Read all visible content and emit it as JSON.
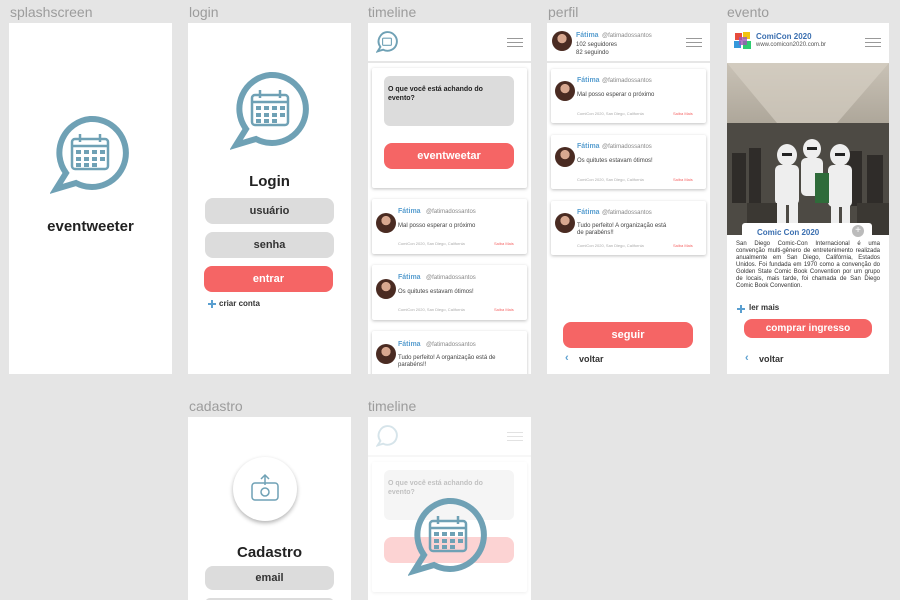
{
  "colors": {
    "accent": "#f56565",
    "brand": "#6fa1b5",
    "field": "#dcdcdc",
    "link": "#5a9fd0"
  },
  "labels": {
    "splash": "splashscreen",
    "login": "login",
    "timeline": "timeline",
    "perfil": "perfil",
    "evento": "evento",
    "cadastro": "cadastro",
    "timeline2": "timeline"
  },
  "splash": {
    "app_name": "eventweeter"
  },
  "login": {
    "title": "Login",
    "user_placeholder": "usuário",
    "password_placeholder": "senha",
    "submit": "entrar",
    "create_account": "criar conta"
  },
  "timeline": {
    "prompt": "O que você está achando do evento?",
    "submit": "eventweetar"
  },
  "posts": [
    {
      "name": "Fátima",
      "handle": "@fatimadossantos",
      "text": "Mal posso esperar o próximo",
      "meta": "ComiCon 2020, San Diego, California",
      "more": "Saiba Mais"
    },
    {
      "name": "Fátima",
      "handle": "@fatimadossantos",
      "text": "Os quitutes estavam ótimos!",
      "meta": "ComiCon 2020, San Diego, California",
      "more": "Saiba Mais"
    },
    {
      "name": "Fátima",
      "handle": "@fatimadossantos",
      "text": "Tudo perfeito! A organização está de parabéns!!",
      "meta": "ComiCon 2020, San Diego, California",
      "more": "Saiba Mais"
    }
  ],
  "perfil": {
    "name": "Fátima",
    "handle": "@fatimadossantos",
    "followers": "102 seguidores",
    "following": "82 seguindo",
    "follow": "seguir",
    "back": "voltar"
  },
  "evento": {
    "name": "ComiCon 2020",
    "url": "www.comicon2020.com.br",
    "caption": "Comic Con 2020",
    "description": "San Diego Comic-Con Internacional é uma convenção multi-gênero de entretenimento realizada anualmente em San Diego, Califórnia, Estados Unidos. Foi fundada em 1970 como a convenção do Golden State Comic Book Convention por um grupo de locais, mais tarde, foi chamada de San Diego Comic Book Convention.",
    "read_more": "ler mais",
    "buy": "comprar ingresso",
    "back": "voltar"
  },
  "cadastro": {
    "title": "Cadastro",
    "email_placeholder": "email"
  },
  "timeline2": {
    "prompt": "O que você está achando do evento?"
  }
}
